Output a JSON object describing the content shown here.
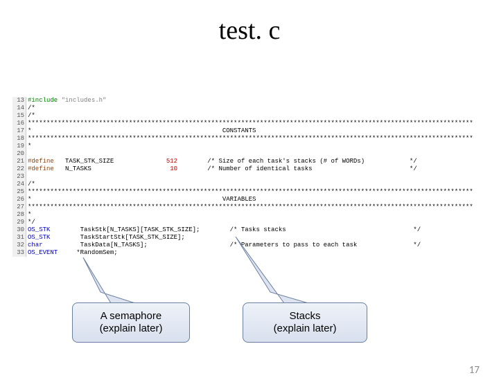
{
  "title": "test. c",
  "page_number": "17",
  "callouts": {
    "semaphore": {
      "line1": "A semaphore",
      "line2": "(explain later)"
    },
    "stacks": {
      "line1": "Stacks",
      "line2": "(explain later)"
    }
  },
  "code": {
    "lines": [
      {
        "n": "13",
        "html": "<span class='kw-green'>#include</span> <span class='kw-gray'>\"includes.h\"</span>"
      },
      {
        "n": "14",
        "html": "/*"
      },
      {
        "n": "15",
        "html": "/*"
      },
      {
        "n": "16",
        "html": "***********************************************************************************************************************"
      },
      {
        "n": "17",
        "html": "*                                                   CONSTANTS"
      },
      {
        "n": "18",
        "html": "***********************************************************************************************************************"
      },
      {
        "n": "19",
        "html": "*"
      },
      {
        "n": "20",
        "html": ""
      },
      {
        "n": "21",
        "html": "<span class='kw-brown'>#define</span>   TASK_STK_SIZE              <span class='kw-red'>512</span>        /* Size of each task's stacks (# of WORDs)            */"
      },
      {
        "n": "22",
        "html": "<span class='kw-brown'>#define</span>   N_TASKS                     <span class='kw-red'>10</span>        /* Number of identical tasks                          */"
      },
      {
        "n": "23",
        "html": ""
      },
      {
        "n": "24",
        "html": "/*"
      },
      {
        "n": "25",
        "html": "***********************************************************************************************************************"
      },
      {
        "n": "26",
        "html": "*                                                   VARIABLES"
      },
      {
        "n": "27",
        "html": "***********************************************************************************************************************"
      },
      {
        "n": "28",
        "html": "*"
      },
      {
        "n": "29",
        "html": "*/"
      },
      {
        "n": "30",
        "html": "<span class='kw-blue'>OS_STK</span>        TaskStk[N_TASKS][TASK_STK_SIZE];        /* Tasks stacks                                  */"
      },
      {
        "n": "31",
        "html": "<span class='kw-blue'>OS_STK</span>        TaskStartStk[TASK_STK_SIZE];"
      },
      {
        "n": "32",
        "html": "<span class='kw-blue'>char</span>          TaskData[N_TASKS];                      /* Parameters to pass to each task               */"
      },
      {
        "n": "33",
        "html": "<span class='kw-blue'>OS_EVENT</span>     *RandomSem;"
      }
    ]
  }
}
